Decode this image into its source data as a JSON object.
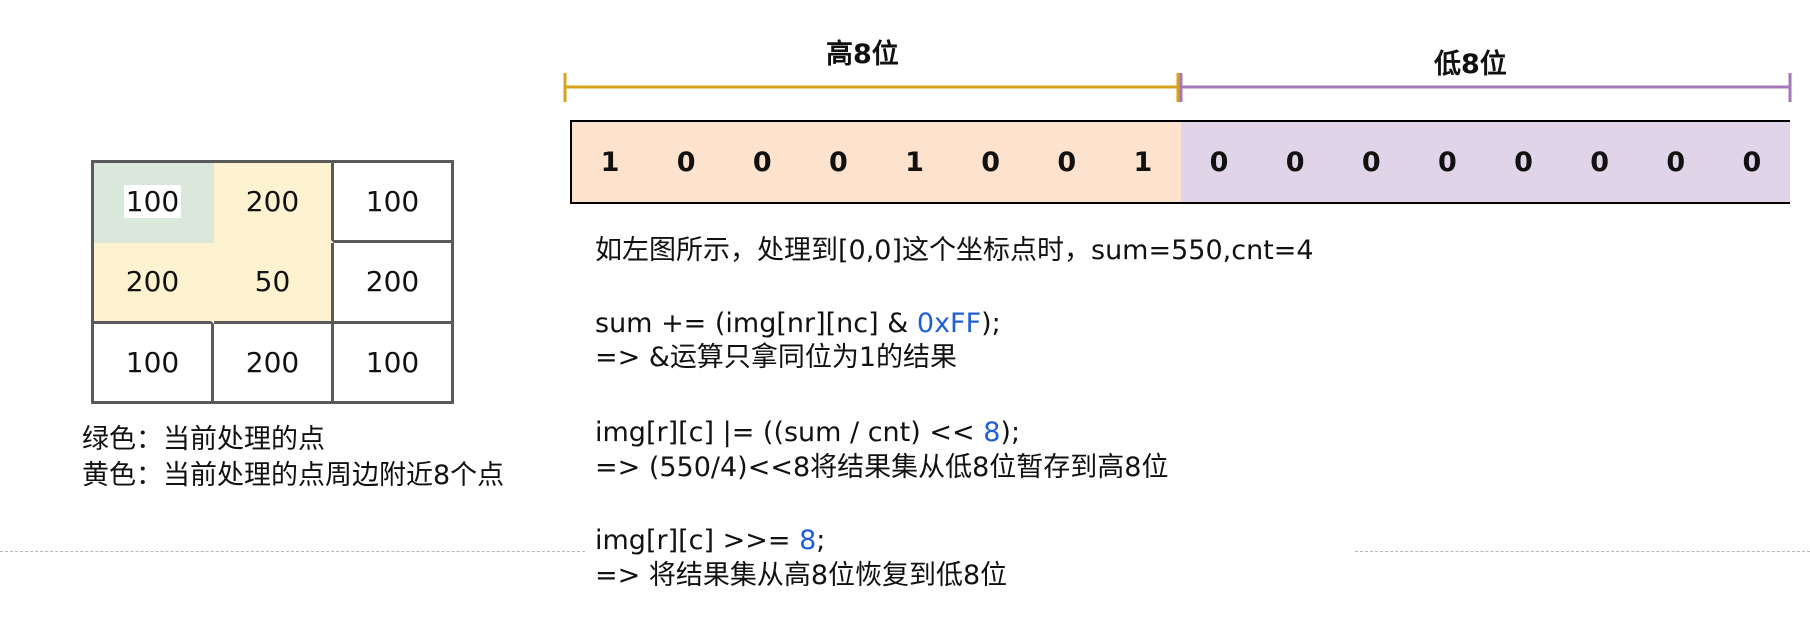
{
  "grid": [
    [
      "100",
      "200",
      "100"
    ],
    [
      "200",
      "50",
      "200"
    ],
    [
      "100",
      "200",
      "100"
    ]
  ],
  "legend": {
    "green": "绿色：当前处理的点",
    "yellow": "黄色：当前处理的点周边附近8个点"
  },
  "bracket": {
    "high_label": "高8位",
    "low_label": "低8位",
    "high_color": "#d9a21b",
    "low_color": "#a479b8"
  },
  "bits": [
    "1",
    "0",
    "0",
    "0",
    "1",
    "0",
    "0",
    "1",
    "0",
    "0",
    "0",
    "0",
    "0",
    "0",
    "0",
    "0"
  ],
  "description": "如左图所示，处理到[0,0]这个坐标点时，sum=550,cnt=4",
  "code1": {
    "pre": "sum += (img[nr][nc] & ",
    "highlight": "0xFF",
    "post": ");",
    "note": "=> &运算只拿同位为1的结果"
  },
  "code2": {
    "pre": "img[r][c] |= ((sum / cnt) << ",
    "highlight": "8",
    "post": ");",
    "note": "=> (550/4)<<8将结果集从低8位暂存到高8位"
  },
  "code3": {
    "pre": "img[r][c] >>= ",
    "highlight": "8",
    "post": ";",
    "note": "=> 将结果集从高8位恢复到低8位"
  },
  "colors": {
    "green_cell": "#d9e8da",
    "yellow_cell": "#fdf2d0",
    "high_bits": "#fde3cd",
    "low_bits": "#e0d5e8",
    "code_highlight": "#1f5fd6"
  }
}
